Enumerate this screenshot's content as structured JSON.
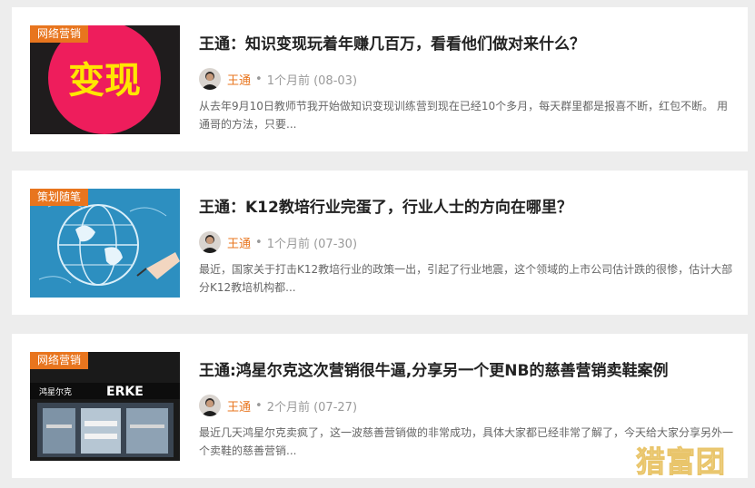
{
  "articles": [
    {
      "tag": "网络营销",
      "title": "王通：知识变现玩着年赚几百万，看看他们做对来什么？",
      "author": "王通",
      "time": "1个月前 (08-03)",
      "excerpt": "从去年9月10日教师节我开始做知识变现训练营到现在已经10个多月，每天群里都是报喜不断，红包不断。 用通哥的方法，只要...",
      "image_text": "变现"
    },
    {
      "tag": "策划随笔",
      "title": "王通：K12教培行业完蛋了，行业人士的方向在哪里？",
      "author": "王通",
      "time": "1个月前 (07-30)",
      "excerpt": "最近，国家关于打击K12教培行业的政策一出，引起了行业地震，这个领域的上市公司估计跌的很惨，估计大部分K12教培机构都..."
    },
    {
      "tag": "网络营销",
      "title": "王通:鸿星尔克这次营销很牛逼,分享另一个更NB的慈善营销卖鞋案例",
      "author": "王通",
      "time": "2个月前 (07-27)",
      "excerpt": "最近几天鸿星尔克卖疯了，这一波慈善营销做的非常成功，具体大家都已经非常了解了，今天给大家分享另外一个卖鞋的慈善营销...",
      "image_text_brand": "鸿星尔克",
      "image_text_logo": "ERKE"
    }
  ],
  "separator": "•",
  "watermark": "猎富团",
  "colors": {
    "accent": "#e8751e",
    "background": "#ededed",
    "title": "#222222"
  }
}
